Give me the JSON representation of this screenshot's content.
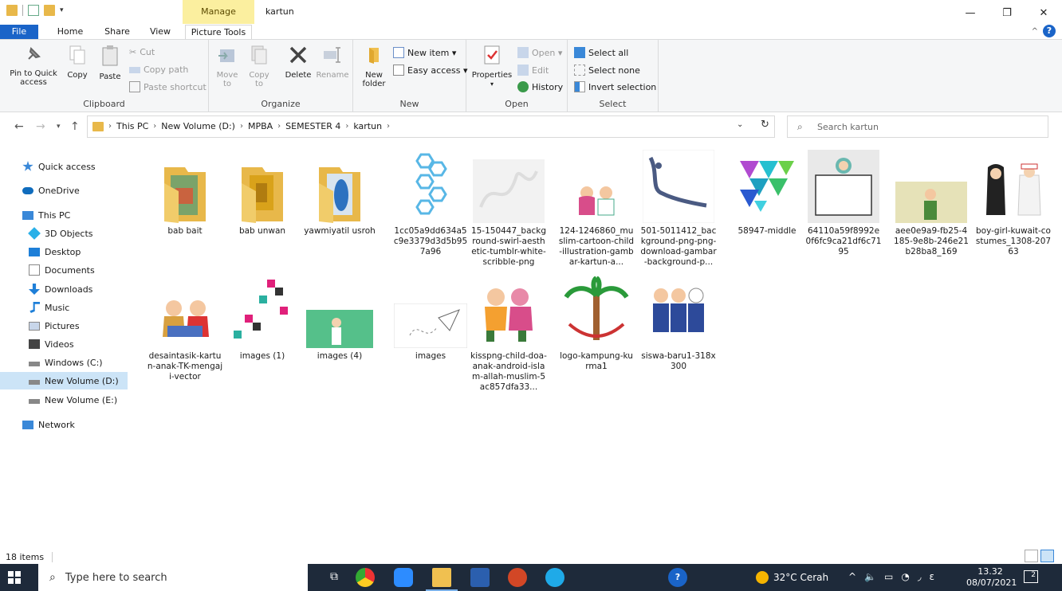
{
  "titlebar": {
    "manage_label": "Manage",
    "title": "kartun",
    "minimize": "—",
    "maximize": "❐",
    "close": "✕"
  },
  "tabs": {
    "file": "File",
    "home": "Home",
    "share": "Share",
    "view": "View",
    "picture_tools": "Picture Tools"
  },
  "ribbon": {
    "clipboard": {
      "pin": "Pin to Quick access",
      "copy": "Copy",
      "paste": "Paste",
      "cut": "Cut",
      "copy_path": "Copy path",
      "paste_shortcut": "Paste shortcut",
      "label": "Clipboard"
    },
    "organize": {
      "move_to": "Move to",
      "copy_to": "Copy to",
      "delete": "Delete",
      "rename": "Rename",
      "label": "Organize"
    },
    "new": {
      "new_folder": "New folder",
      "new_item": "New item ▾",
      "easy_access": "Easy access ▾",
      "label": "New"
    },
    "open": {
      "properties": "Properties",
      "open": "Open ▾",
      "edit": "Edit",
      "history": "History",
      "label": "Open"
    },
    "select": {
      "select_all": "Select all",
      "select_none": "Select none",
      "invert": "Invert selection",
      "label": "Select"
    }
  },
  "address": {
    "crumbs": [
      "This PC",
      "New Volume (D:)",
      "MPBA",
      "SEMESTER 4",
      "kartun"
    ],
    "search_placeholder": "Search kartun"
  },
  "sidebar": {
    "items": [
      {
        "label": "Quick access",
        "icon": "star-icon"
      },
      {
        "label": "OneDrive",
        "icon": "cloud-icon"
      },
      {
        "label": "This PC",
        "icon": "monitor-icon"
      },
      {
        "label": "3D Objects",
        "icon": "cube-icon"
      },
      {
        "label": "Desktop",
        "icon": "desktop-icon"
      },
      {
        "label": "Documents",
        "icon": "document-icon"
      },
      {
        "label": "Downloads",
        "icon": "download-icon"
      },
      {
        "label": "Music",
        "icon": "music-icon"
      },
      {
        "label": "Pictures",
        "icon": "pictures-icon"
      },
      {
        "label": "Videos",
        "icon": "videos-icon"
      },
      {
        "label": "Windows (C:)",
        "icon": "drive-icon"
      },
      {
        "label": "New Volume (D:)",
        "icon": "drive-icon"
      },
      {
        "label": "New Volume (E:)",
        "icon": "drive-icon"
      },
      {
        "label": "Network",
        "icon": "network-icon"
      }
    ],
    "selected": "New Volume (D:)"
  },
  "files": [
    {
      "name": "bab bait",
      "kind": "folder"
    },
    {
      "name": "bab unwan",
      "kind": "folder"
    },
    {
      "name": "yawmiyatil usroh",
      "kind": "folder"
    },
    {
      "name": "1cc05a9dd634a5c9e3379d3d5b957a96",
      "kind": "image"
    },
    {
      "name": "15-150447_background-swirl-aesthetic-tumblr-white-scribble-png",
      "kind": "image"
    },
    {
      "name": "124-1246860_muslim-cartoon-child-illustration-gambar-kartun-a...",
      "kind": "image"
    },
    {
      "name": "501-5011412_background-png-png-download-gambar-background-p...",
      "kind": "image"
    },
    {
      "name": "58947-middle",
      "kind": "image"
    },
    {
      "name": "64110a59f8992e0f6fc9ca21df6c7195",
      "kind": "image"
    },
    {
      "name": "aee0e9a9-fb25-4185-9e8b-246e21b28ba8_169",
      "kind": "image"
    },
    {
      "name": "boy-girl-kuwait-costumes_1308-20763",
      "kind": "image"
    },
    {
      "name": "desaintasik-kartun-anak-TK-mengaji-vector",
      "kind": "image"
    },
    {
      "name": "images (1)",
      "kind": "image"
    },
    {
      "name": "images (4)",
      "kind": "image"
    },
    {
      "name": "images",
      "kind": "image"
    },
    {
      "name": "kisspng-child-doa-anak-android-islam-allah-muslim-5ac857dfa33...",
      "kind": "image"
    },
    {
      "name": "logo-kampung-kurma1",
      "kind": "image"
    },
    {
      "name": "siswa-baru1-318x300",
      "kind": "image"
    }
  ],
  "status": {
    "item_count": "18 items"
  },
  "taskbar": {
    "search_text": "Type here to search",
    "weather": "32°C Cerah",
    "time": "13.32",
    "date": "08/07/2021",
    "notifications": "2",
    "lang": "ε"
  },
  "colors": {
    "accent": "#1a64c8",
    "manage_tab": "#fbef9f",
    "selection": "#cce4f7",
    "taskbar": "#1e2a3a",
    "folder": "#e8b84a"
  }
}
